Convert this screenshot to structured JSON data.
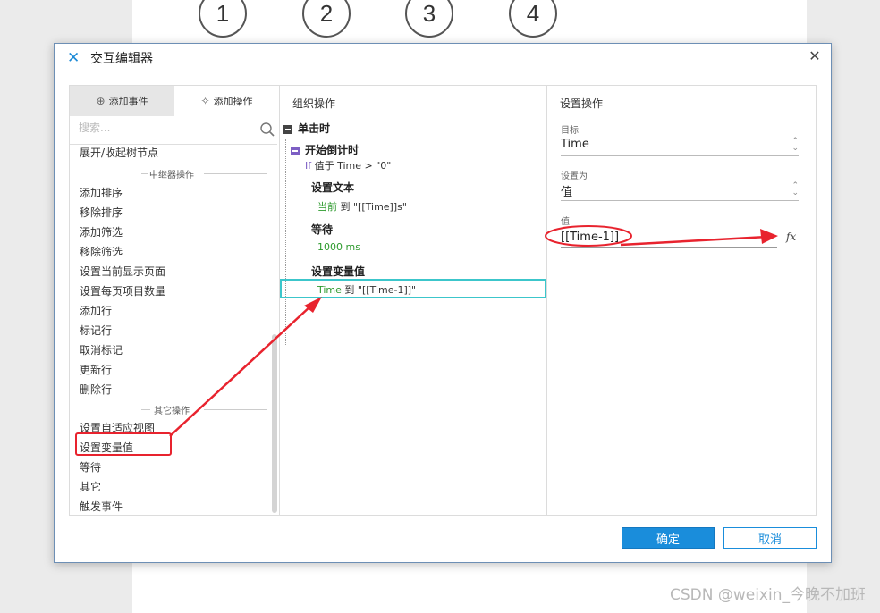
{
  "background": {
    "step_circles": [
      "1",
      "2",
      "3",
      "4"
    ],
    "watermark": "CSDN @weixin_今晚不加班"
  },
  "dialog": {
    "title": "交互编辑器",
    "colors": {
      "accent": "#1a8ddb",
      "highlight_red": "#e8232e",
      "selection_teal": "#3cc6cb",
      "green_text": "#2d9a2d",
      "purple": "#7d5fc4"
    }
  },
  "left_panel": {
    "tabs": [
      {
        "label": "添加事件",
        "icon": "add-event-icon"
      },
      {
        "label": "添加操作",
        "icon": "add-action-icon"
      }
    ],
    "search_placeholder": "搜索...",
    "items_top": [
      "展开/收起树节点"
    ],
    "group_relay": "中继器操作",
    "items_relay": [
      "添加排序",
      "移除排序",
      "添加筛选",
      "移除筛选",
      "设置当前显示页面",
      "设置每页项目数量",
      "添加行",
      "标记行",
      "取消标记",
      "更新行",
      "删除行"
    ],
    "group_other": "其它操作",
    "items_other": [
      "设置自适应视图",
      "设置变量值",
      "等待",
      "其它",
      "触发事件"
    ]
  },
  "mid_panel": {
    "title": "组织操作",
    "event": "单击时",
    "case": "开始倒计时",
    "condition_prefix": "If",
    "condition": "值于 Time > \"0\"",
    "actions": [
      {
        "name": "设置文本",
        "detail_green": "当前",
        "detail_rest": " 到 \"[[Time]]s\""
      },
      {
        "name": "等待",
        "detail_green": "1000 ms",
        "detail_rest": ""
      },
      {
        "name": "设置变量值",
        "detail_green": "Time",
        "detail_rest": " 到 \"[[Time-1]]\""
      }
    ]
  },
  "right_panel": {
    "title": "设置操作",
    "target_label": "目标",
    "target_value": "Time",
    "set_as_label": "设置为",
    "set_as_value": "值",
    "value_label": "值",
    "value_text": "[[Time-1]]",
    "fx_label": "fx"
  },
  "buttons": {
    "ok": "确定",
    "cancel": "取消"
  }
}
